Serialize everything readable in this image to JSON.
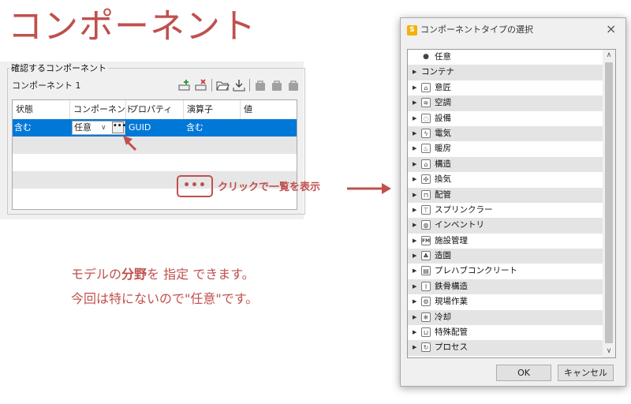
{
  "page_title": "コンポーネント",
  "left_panel": {
    "group_label": "確認するコンポーネント",
    "component_label": "コンポーネント 1",
    "toolbar_icons": [
      "add-row-icon",
      "delete-row-icon",
      "folder-open-icon",
      "download-icon",
      "bag-icon",
      "bag-icon",
      "bag-icon"
    ],
    "grid": {
      "headers": [
        "状態",
        "コンポーネント",
        "プロパティ",
        "演算子",
        "値"
      ],
      "row": {
        "state": "含む",
        "component": "任意",
        "ellipsis": "•••",
        "property": "GUID",
        "operator": "含む",
        "value": ""
      }
    }
  },
  "callout": {
    "button": "•••",
    "text": "クリックで一覧を表示"
  },
  "note": {
    "line1_a": "モデルの",
    "line1_b": "分野",
    "line1_c": "を 指定 できます。",
    "line2": "今回は特にないので\"任意\"です。"
  },
  "dialog": {
    "app_icon": "S",
    "title": "コンポーネントタイプの選択",
    "close": "×",
    "items": [
      {
        "label": "任意",
        "icon": "dot-icon",
        "arrow": "",
        "g": "●"
      },
      {
        "label": "コンテナ",
        "icon": "",
        "arrow": "▶",
        "g": ""
      },
      {
        "label": "意匠",
        "icon": "building-icon",
        "arrow": "▶",
        "g": "⌂"
      },
      {
        "label": "空調",
        "icon": "air-icon",
        "arrow": "▶",
        "g": "≋"
      },
      {
        "label": "設備",
        "icon": "equipment-icon",
        "arrow": "▶",
        "g": "◌"
      },
      {
        "label": "電気",
        "icon": "electric-icon",
        "arrow": "▶",
        "g": "ϟ"
      },
      {
        "label": "暖房",
        "icon": "heating-icon",
        "arrow": "▶",
        "g": "♨"
      },
      {
        "label": "構造",
        "icon": "structure-icon",
        "arrow": "▶",
        "g": "⌂"
      },
      {
        "label": "換気",
        "icon": "fan-icon",
        "arrow": "▶",
        "g": "✣"
      },
      {
        "label": "配管",
        "icon": "pipe-icon",
        "arrow": "▶",
        "g": "⊓"
      },
      {
        "label": "スプリンクラー",
        "icon": "sprinkler-icon",
        "arrow": "▶",
        "g": "⊤"
      },
      {
        "label": "インベントリ",
        "icon": "inventory-icon",
        "arrow": "▶",
        "g": "◍"
      },
      {
        "label": "施設管理",
        "icon": "fm-icon",
        "arrow": "▶",
        "g": "FM"
      },
      {
        "label": "造園",
        "icon": "landscape-icon",
        "arrow": "▶",
        "g": "♣"
      },
      {
        "label": "プレハブコンクリート",
        "icon": "precast-icon",
        "arrow": "▶",
        "g": "▤"
      },
      {
        "label": "鉄骨構造",
        "icon": "steel-icon",
        "arrow": "▶",
        "g": "I"
      },
      {
        "label": "現場作業",
        "icon": "sitework-icon",
        "arrow": "▶",
        "g": "⚙"
      },
      {
        "label": "冷却",
        "icon": "cooling-icon",
        "arrow": "▶",
        "g": "❄"
      },
      {
        "label": "特殊配管",
        "icon": "special-pipe-icon",
        "arrow": "▶",
        "g": "⊔"
      },
      {
        "label": "プロセス",
        "icon": "process-icon",
        "arrow": "▶",
        "g": "↻"
      }
    ],
    "ok": "OK",
    "cancel": "キャンセル"
  },
  "colors": {
    "accent": "#c0504d",
    "selection": "#0078d7"
  }
}
